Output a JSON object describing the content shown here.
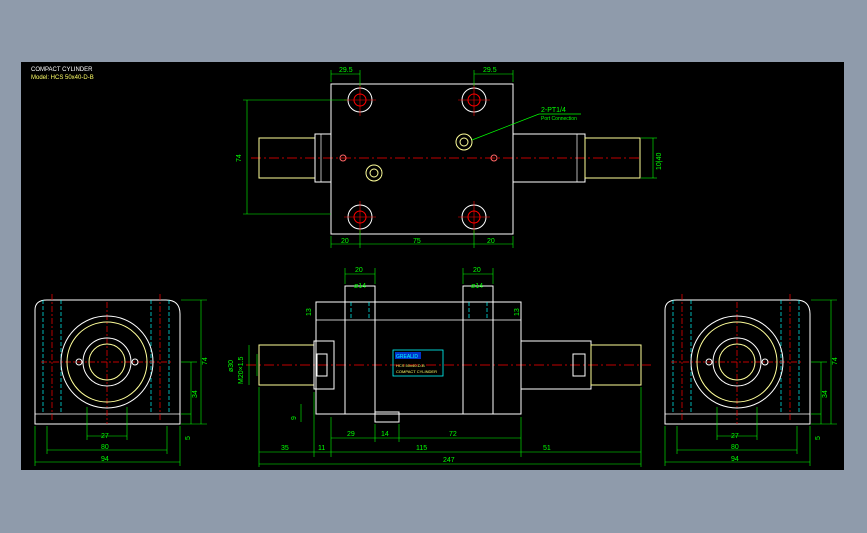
{
  "title_block": {
    "title": "COMPACT CYLINDER",
    "model": "Model: HCS 50x40-D-B"
  },
  "callout": {
    "port_label": "2-PT1/4",
    "port_sub": "Port Connection"
  },
  "nameplate": {
    "brand": "GREALID",
    "line1": "HCS 50x40-D-B",
    "line2": "COMPACT CYLINDER"
  },
  "top_view": {
    "dim_top_left": "29.5",
    "dim_top_right": "29.5",
    "dim_height": "74",
    "dim_bottom_left": "20",
    "dim_bottom_mid": "75",
    "dim_bottom_right": "20",
    "dim_rod": "10|40"
  },
  "front_view": {
    "dim_top_left": "20",
    "dim_top_right": "20",
    "dim_bore_left": "ø14",
    "dim_bore_right": "ø14",
    "dim_side_left": "13",
    "dim_side_right": "13",
    "dim_rod_dia": "ø30",
    "dim_rod_thread": "M20×1.5",
    "dim_9": "9",
    "dim_35": "35",
    "dim_11": "11",
    "dim_29": "29",
    "dim_14": "14",
    "dim_72": "72",
    "dim_115": "115",
    "dim_51": "51",
    "dim_247": "247"
  },
  "side_view_left": {
    "dim_27": "27",
    "dim_80": "80",
    "dim_94": "94",
    "dim_74": "74",
    "dim_34": "34",
    "dim_5": "5"
  },
  "side_view_right": {
    "dim_27": "27",
    "dim_80": "80",
    "dim_94": "94",
    "dim_74": "74",
    "dim_34": "34",
    "dim_5": "5"
  },
  "colors": {
    "background": "#8f9bab",
    "canvas": "#000000",
    "outline": "#ffffff",
    "dimension": "#00ff00",
    "centerline": "#ff0000",
    "hidden": "#00ffff",
    "rod": "#ffff99"
  }
}
